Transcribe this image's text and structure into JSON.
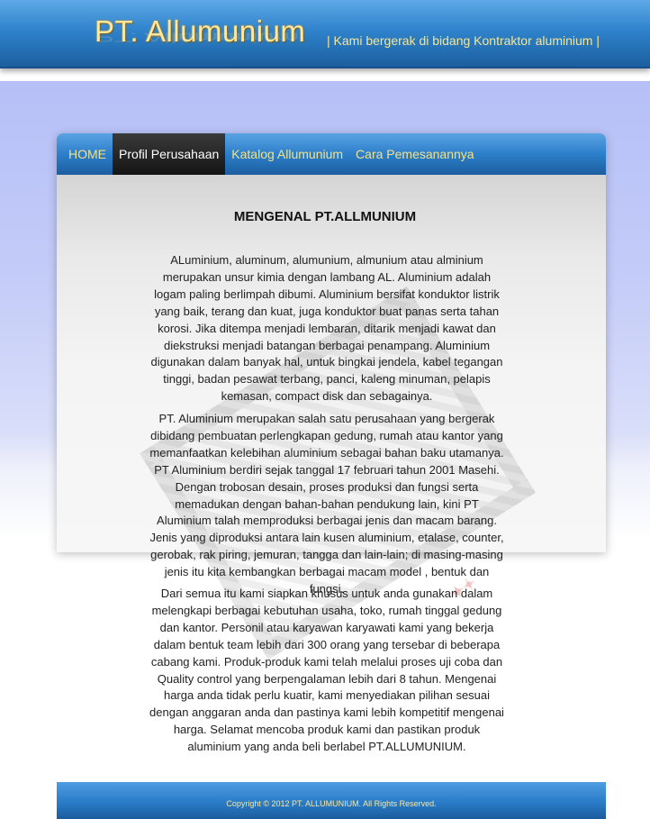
{
  "header": {
    "logo": "PT. Allumunium",
    "tagline": "| Kami bergerak di bidang Kontraktor aluminium |"
  },
  "nav": {
    "items": [
      {
        "label": "HOME",
        "active": false
      },
      {
        "label": "Profil Perusahaan",
        "active": true
      },
      {
        "label": "Katalog Allumunium",
        "active": false
      },
      {
        "label": "Cara Pemesanannya",
        "active": false
      }
    ]
  },
  "content": {
    "title": "MENGENAL PT.ALLMUNIUM",
    "paragraphs": [
      "ALuminium, aluminum, alumunium, almunium atau alminium merupakan unsur kimia dengan lambang AL. Aluminium adalah logam paling berlimpah dibumi. Aluminium bersifat konduktor listrik yang baik, terang dan kuat, juga konduktor buat panas serta tahan korosi. Jika ditempa menjadi lembaran, ditarik menjadi kawat dan diekstruksi menjadi batangan berbagai penampang. Aluminium digunakan dalam banyak hal, untuk bingkai jendela, kabel tegangan tinggi, badan pesawat terbang, panci, kaleng minuman, pelapis kemasan, compact disk dan sebagainya.",
      "PT. Aluminium merupakan salah satu perusahaan yang bergerak dibidang pembuatan perlengkapan gedung, rumah atau kantor yang memanfaatkan kelebihan aluminium sebagai bahan baku utamanya. PT Aluminium berdiri sejak tanggal 17 februari tahun 2001 Masehi. Dengan trobosan desain, proses produksi dan fungsi serta memadukan dengan bahan-bahan pendukung lain, kini PT Aluminium talah memproduksi berbagai jenis dan macam barang. Jenis yang diproduksi antara lain kusen aluminium, etalase, counter, gerobak, rak piring, jemuran, tangga dan lain-lain; di masing-masing jenis itu kita kembangkan berbagai macam model , bentuk dan fungsi.",
      "Dari semua itu kami siapkan khusus untuk anda gunakan dalam melengkapi berbagai kebutuhan usaha, toko, rumah tinggal gedung dan kantor. Personil atau karyawan karyawati kami yang bekerja dalam bentuk team lebih dari 300 orang yang tersebar di beberapa cabang kami. Produk-produk kami telah melalui proses uji coba dan Quality control yang berpengalaman lebih dari 8 tahun. Mengenai harga anda tidak perlu kuatir, kami menyediakan pilihan sesuai dengan anggaran anda dan pastinya kami lebih kompetitif mengenai harga. Selamat mencoba produk kami dan pastikan produk aluminium yang anda beli berlabel PT.ALLUMUNIUM."
    ]
  },
  "footer": {
    "copyright": "Copyright © 2012 PT. ALLUMUNIUM. All Rights Reserved."
  }
}
